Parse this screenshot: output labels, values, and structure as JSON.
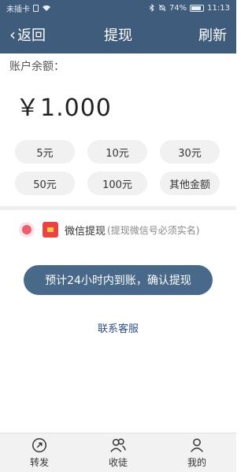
{
  "status_bar": {
    "carrier": "未插卡",
    "battery": "74%",
    "time": "11:13"
  },
  "header": {
    "back_label": "返回",
    "title": "提现",
    "refresh_label": "刷新"
  },
  "balance": {
    "label": "账户余额：",
    "amount": "￥1.000"
  },
  "amounts": [
    "5元",
    "10元",
    "30元",
    "50元",
    "100元",
    "其他金额"
  ],
  "withdraw_method": {
    "label": "微信提现",
    "note": "(提现微信号必须实名)",
    "selected": true
  },
  "confirm_button": "预计24小时内到账，确认提现",
  "contact_link": "联系客服",
  "tabbar": {
    "items": [
      {
        "label": "转发",
        "icon": "share-icon"
      },
      {
        "label": "收徒",
        "icon": "users-icon"
      },
      {
        "label": "我的",
        "icon": "user-icon"
      }
    ]
  },
  "colors": {
    "header": "#405c7c",
    "button": "#48698a",
    "radio": "#ee5c70",
    "link": "#2c4f86"
  }
}
